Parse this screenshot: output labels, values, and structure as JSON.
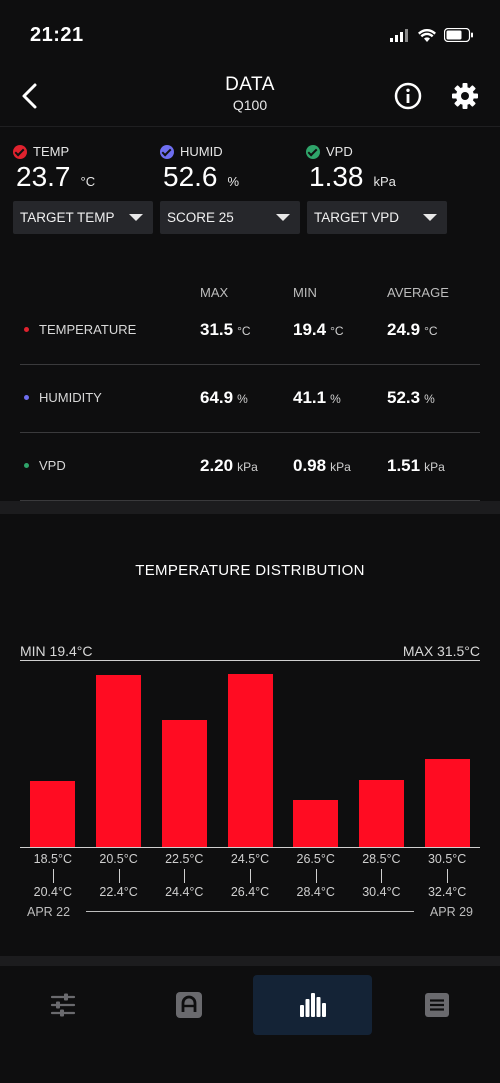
{
  "status": {
    "time": "21:21"
  },
  "header": {
    "title": "DATA",
    "subtitle": "Q100"
  },
  "readings": [
    {
      "label": "TEMP",
      "value": "23.7",
      "unit": "°C",
      "color": "#e0222e"
    },
    {
      "label": "HUMID",
      "value": "52.6",
      "unit": "%",
      "color": "#6e6ef0"
    },
    {
      "label": "VPD",
      "value": "1.38",
      "unit": "kPa",
      "color": "#2fa46a"
    }
  ],
  "dropdowns": [
    "TARGET TEMP",
    "SCORE 25",
    "TARGET VPD"
  ],
  "stats": {
    "headers": [
      "MAX",
      "MIN",
      "AVERAGE"
    ],
    "rows": [
      {
        "label": "TEMPERATURE",
        "color": "#e0222e",
        "max": "31.5",
        "min": "19.4",
        "avg": "24.9",
        "unit": "°C"
      },
      {
        "label": "HUMIDITY",
        "color": "#6e6ef0",
        "max": "64.9",
        "min": "41.1",
        "avg": "52.3",
        "unit": "%"
      },
      {
        "label": "VPD",
        "color": "#2fa46a",
        "max": "2.20",
        "min": "0.98",
        "avg": "1.51",
        "unit": "kPa"
      }
    ]
  },
  "chart_data": {
    "type": "bar",
    "title": "TEMPERATURE DISTRIBUTION",
    "min_label": "MIN 19.4°C",
    "max_label": "MAX 31.5°C",
    "categories_from": [
      "18.5°C",
      "20.5°C",
      "22.5°C",
      "24.5°C",
      "26.5°C",
      "28.5°C",
      "30.5°C"
    ],
    "categories_to": [
      "20.4°C",
      "22.4°C",
      "24.4°C",
      "26.4°C",
      "28.4°C",
      "30.4°C",
      "32.4°C"
    ],
    "values": [
      60,
      156,
      115,
      157,
      43,
      61,
      80
    ],
    "ylim": [
      0,
      160
    ],
    "color": "#ff0c22",
    "date_start": "APR 22",
    "date_end": "APR 29"
  },
  "nav": {
    "items": [
      "sliders-icon",
      "a-icon",
      "bar-chart-icon",
      "list-icon"
    ],
    "active": 2
  }
}
